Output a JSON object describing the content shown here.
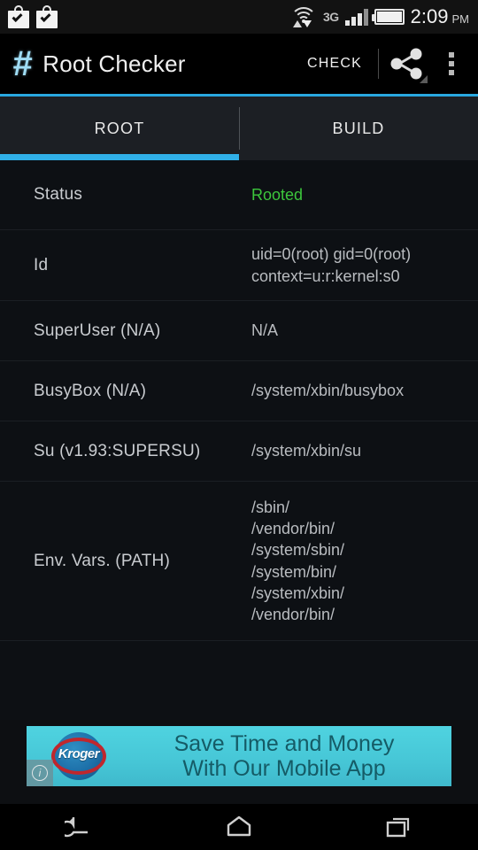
{
  "status_bar": {
    "notifications": [
      {
        "icon": "download-complete-bag-icon"
      },
      {
        "icon": "download-complete-bag-icon"
      }
    ],
    "wifi_icon": "wifi-transfer-icon",
    "network_type": "3G",
    "signal_bars": 3,
    "signal_bars_total": 4,
    "battery_icon": "battery-full-icon",
    "time": "2:09",
    "am_pm": "PM"
  },
  "action_bar": {
    "logo_glyph": "#",
    "logo_icon": "hash-logo-icon",
    "title": "Root Checker",
    "check_label": "CHECK",
    "share_icon": "share-icon",
    "overflow_icon": "overflow-menu-icon",
    "accent_color": "#29a8e0"
  },
  "tabs": [
    {
      "label": "ROOT",
      "active": true
    },
    {
      "label": "BUILD",
      "active": false
    }
  ],
  "rows": [
    {
      "label": "Status",
      "value": "Rooted",
      "state": "ok"
    },
    {
      "label": "Id",
      "value": "uid=0(root) gid=0(root)\ncontext=u:r:kernel:s0"
    },
    {
      "label": "SuperUser (N/A)",
      "value": "N/A"
    },
    {
      "label": "BusyBox (N/A)",
      "value": "/system/xbin/busybox"
    },
    {
      "label": "Su (v1.93:SUPERSU)",
      "value": "/system/xbin/su"
    },
    {
      "label": "Env. Vars. (PATH)",
      "value": "/sbin/\n/vendor/bin/\n/system/sbin/\n/system/bin/\n/system/xbin/\n/vendor/bin/"
    }
  ],
  "ad": {
    "brand": "Kroger",
    "headline": "Save Time and Money\nWith Our Mobile App",
    "info_badge": "i",
    "background_color": "#46c6d6",
    "text_color": "#155b66"
  },
  "nav_bar": {
    "back_icon": "back-arrow-icon",
    "home_icon": "home-icon",
    "recents_icon": "recent-apps-icon"
  },
  "colors": {
    "status_ok": "#3cc63c",
    "accent": "#29a8e0",
    "tab_indicator": "#30b0e8"
  }
}
